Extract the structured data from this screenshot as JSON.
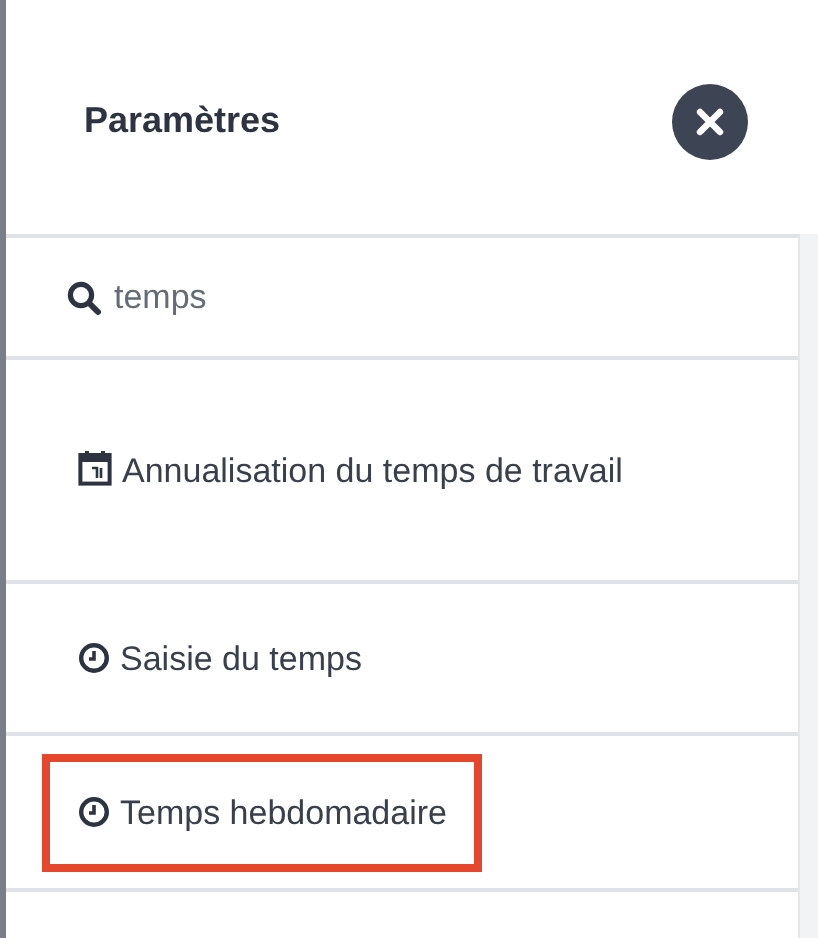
{
  "panel": {
    "title": "Paramètres"
  },
  "search": {
    "value": "temps"
  },
  "items": [
    {
      "kind": "calendar",
      "label": "Annualisation du temps de travail",
      "highlighted": false
    },
    {
      "kind": "clock",
      "label": "Saisie du temps",
      "highlighted": false
    },
    {
      "kind": "clock",
      "label": "Temps hebdomadaire",
      "highlighted": true
    }
  ]
}
